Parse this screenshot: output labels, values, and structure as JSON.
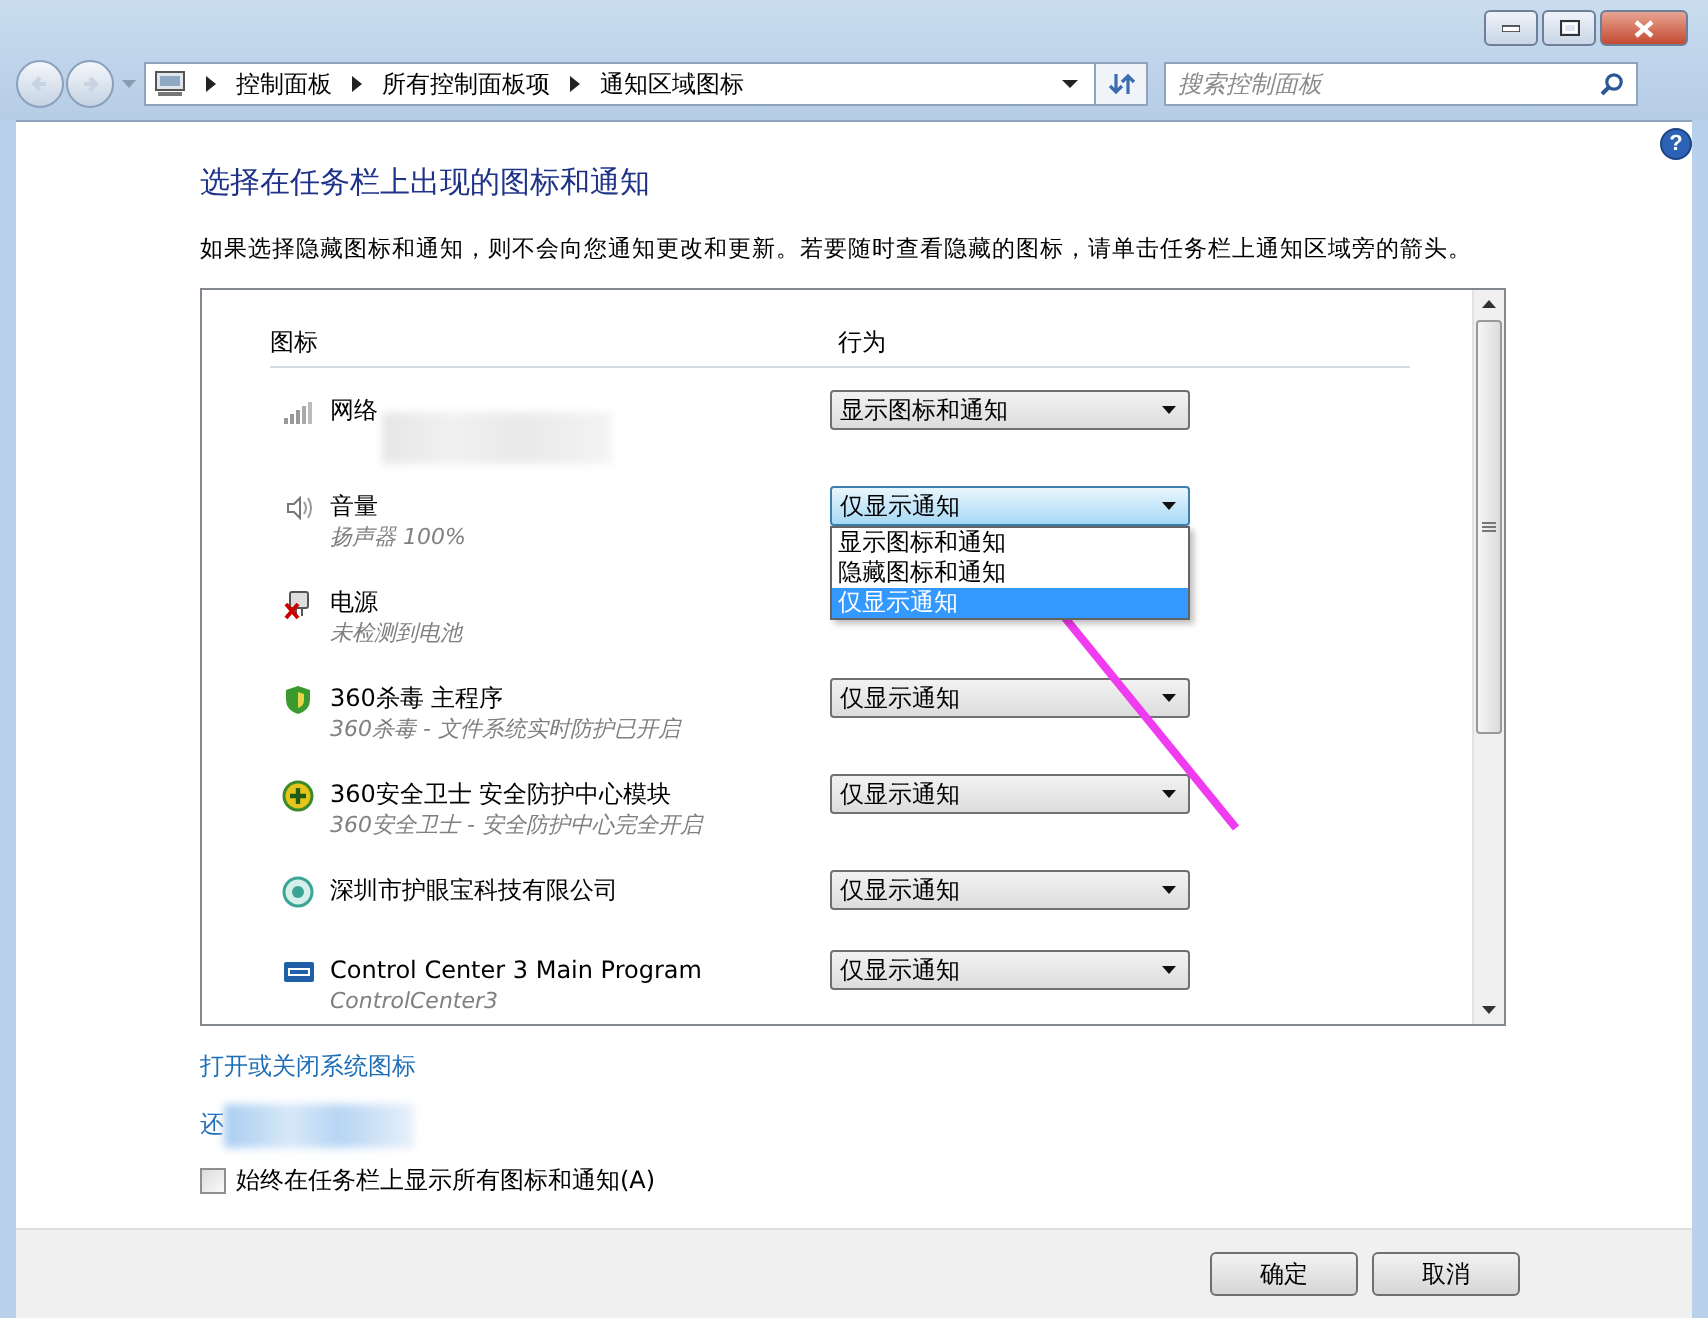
{
  "address_bar": {
    "breadcrumbs": [
      "控制面板",
      "所有控制面板项",
      "通知区域图标"
    ]
  },
  "search": {
    "placeholder": "搜索控制面板"
  },
  "help": "?",
  "heading": "选择在任务栏上出现的图标和通知",
  "description": "如果选择隐藏图标和通知，则不会向您通知更改和更新。若要随时查看隐藏的图标，请单击任务栏上通知区域旁的箭头。",
  "list": {
    "columns": [
      "图标",
      "行为"
    ],
    "rows": [
      {
        "name": "网络",
        "redacted": true,
        "behavior": "显示图标和通知",
        "expanded": false
      },
      {
        "name": "音量",
        "subtitle": "扬声器 100%",
        "behavior": "仅显示通知",
        "expanded": true,
        "options": [
          {
            "label": "显示图标和通知",
            "selected": false
          },
          {
            "label": "隐藏图标和通知",
            "selected": false
          },
          {
            "label": "仅显示通知",
            "selected": true
          }
        ]
      },
      {
        "name": "电源",
        "subtitle": "未检测到电池"
      },
      {
        "name": "360杀毒 主程序",
        "subtitle": "360杀毒 - 文件系统实时防护已开启",
        "behavior": "仅显示通知",
        "expanded": false
      },
      {
        "name": "360安全卫士 安全防护中心模块",
        "subtitle": "360安全卫士 - 安全防护中心完全开启",
        "behavior": "仅显示通知",
        "expanded": false
      },
      {
        "name": "深圳市护眼宝科技有限公司",
        "behavior": "仅显示通知",
        "expanded": false
      },
      {
        "name": "Control Center 3 Main Program",
        "subtitle": "ControlCenter3",
        "behavior": "仅显示通知",
        "expanded": false
      }
    ]
  },
  "links": [
    {
      "label": "打开或关闭系统图标",
      "redacted": false
    },
    {
      "label": "还",
      "redacted": true
    }
  ],
  "checkbox": {
    "label": "始终在任务栏上显示所有图标和通知(A)",
    "checked": false
  },
  "buttons": [
    "确定",
    "取消"
  ]
}
